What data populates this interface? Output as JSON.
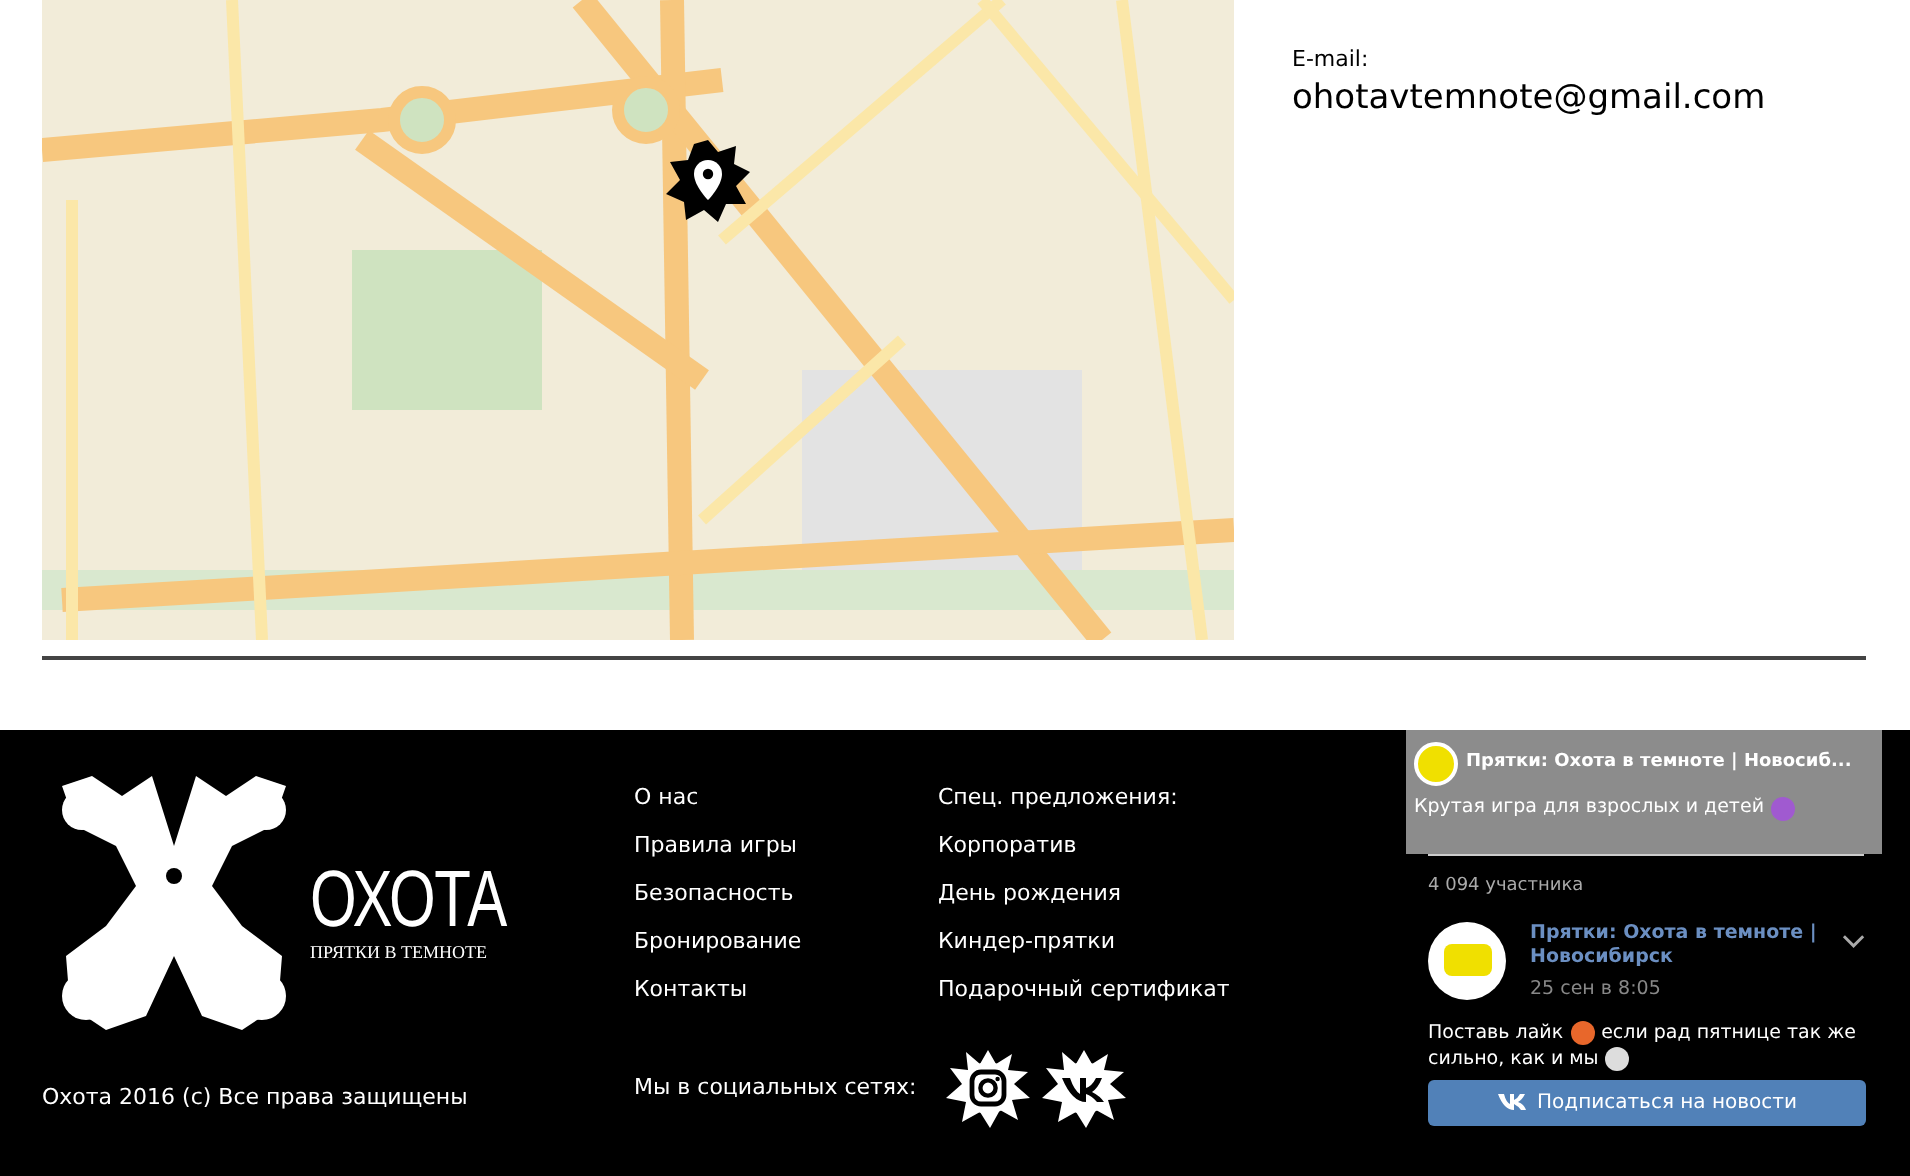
{
  "contact": {
    "label": "E-mail:",
    "email": "ohotavtemnote@gmail.com"
  },
  "footer": {
    "logo": {
      "title": "ОХОТА",
      "subtitle": "ПРЯТКИ В ТЕМНОТЕ"
    },
    "copyright": "Охота 2016 (с) Все права защищены",
    "menu": [
      "О нас",
      "Правила игры",
      "Безопасность",
      "Бронирование",
      "Контакты"
    ],
    "offers": {
      "heading": "Спец. предложения:",
      "items": [
        "Корпоратив",
        "День рождения",
        "Киндер-прятки",
        "Подарочный сертификат"
      ]
    },
    "social": {
      "label": "Мы в социальных сетях:",
      "links": [
        {
          "kind": "instagram"
        },
        {
          "kind": "vk"
        }
      ]
    }
  },
  "widget": {
    "cover_title": "Прятки: Охота в темноте | Новосиб...",
    "cover_text": "Крутая игра для взрослых и детей",
    "members": "4 094 участника",
    "post": {
      "author": "Прятки: Охота в темноте | Новосибирск",
      "date": "25 сен в 8:05",
      "text_line_1": "Поставь лайк",
      "text_line_2": "если рад пятнице так же",
      "text_line_3": "сильно, как и мы"
    },
    "subscribe": "Подписаться на новости"
  }
}
